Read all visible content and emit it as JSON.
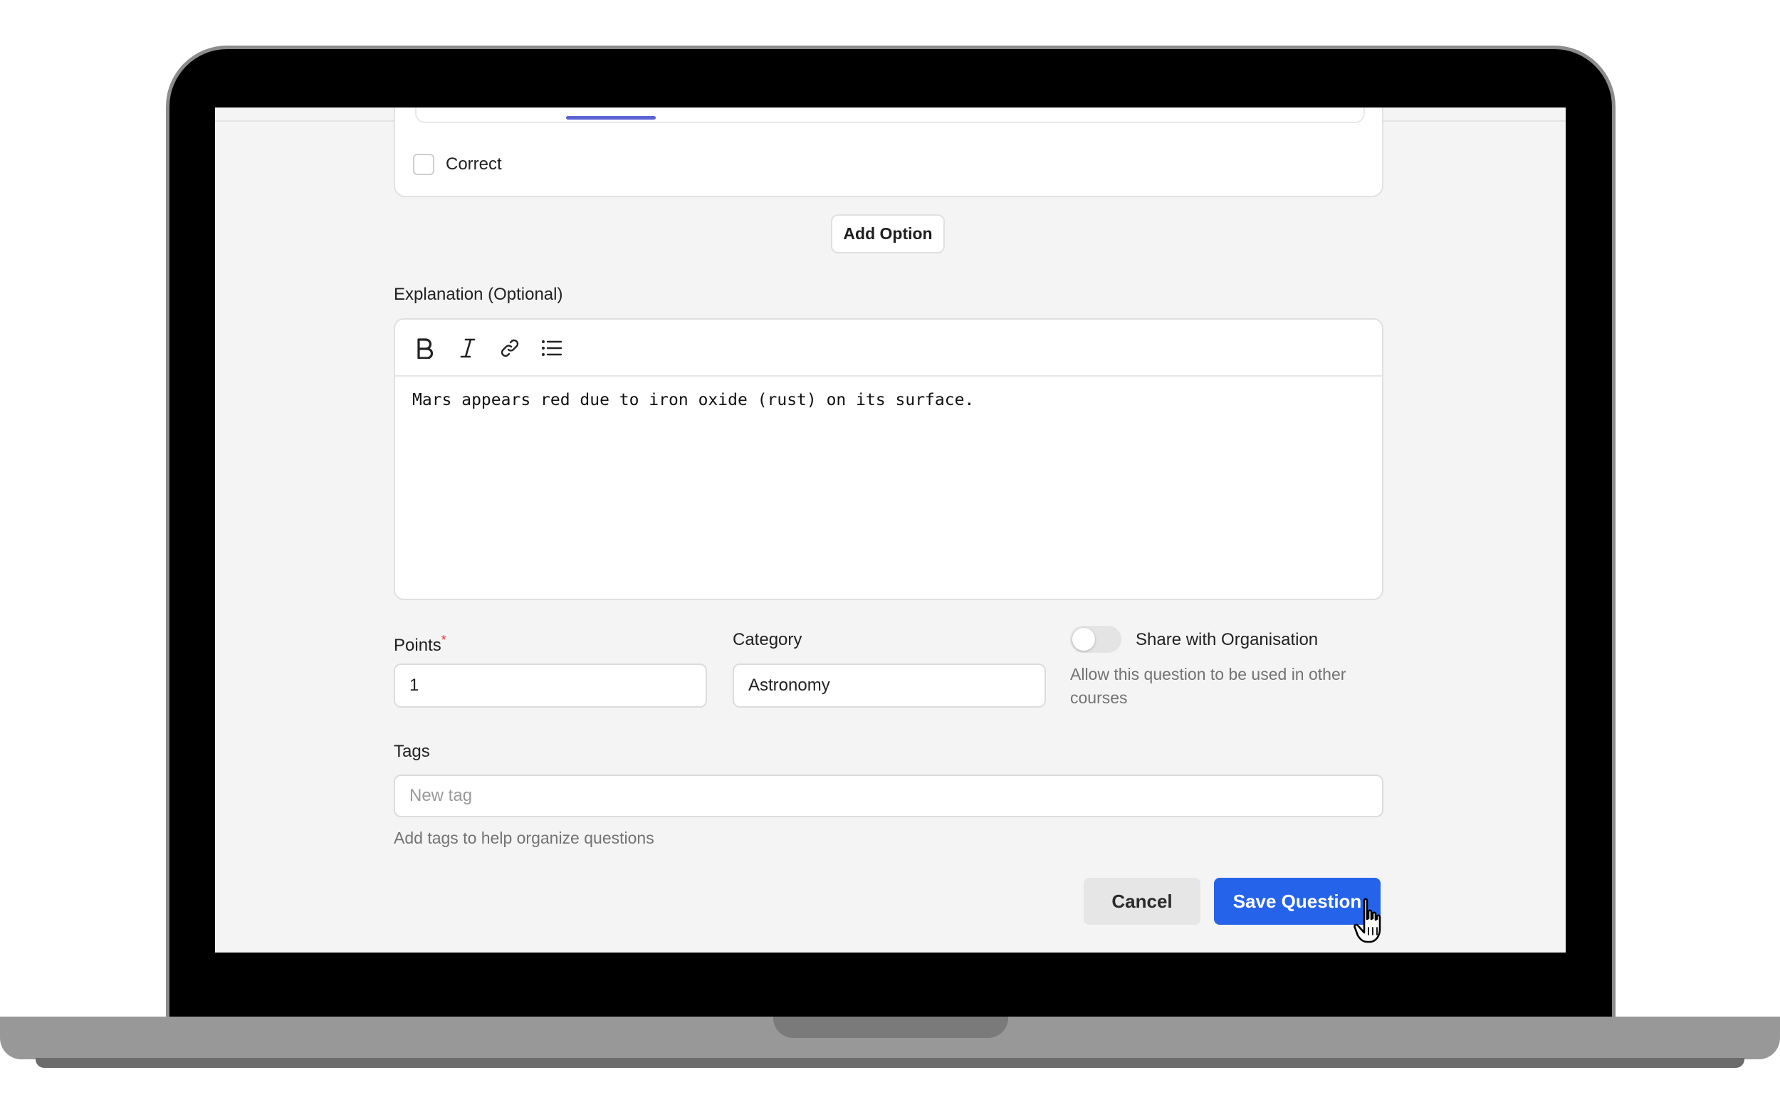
{
  "option": {
    "correct_label": "Correct"
  },
  "add_option_label": "Add Option",
  "explanation": {
    "label": "Explanation (Optional)",
    "toolbar": [
      "bold-icon",
      "italic-icon",
      "link-icon",
      "list-icon"
    ],
    "content": "Mars appears red due to iron oxide (rust) on its surface."
  },
  "points": {
    "label": "Points",
    "required_mark": "*",
    "value": "1"
  },
  "category": {
    "label": "Category",
    "value": "Astronomy"
  },
  "share": {
    "label": "Share with Organisation",
    "enabled": false,
    "helper": "Allow this question to be used in other courses"
  },
  "tags": {
    "label": "Tags",
    "placeholder": "New tag",
    "helper": "Add tags to help organize questions"
  },
  "actions": {
    "cancel_label": "Cancel",
    "save_label": "Save Question"
  },
  "colors": {
    "primary": "#2563eb",
    "tab_indicator": "#5b63d3",
    "required": "#e53935"
  }
}
